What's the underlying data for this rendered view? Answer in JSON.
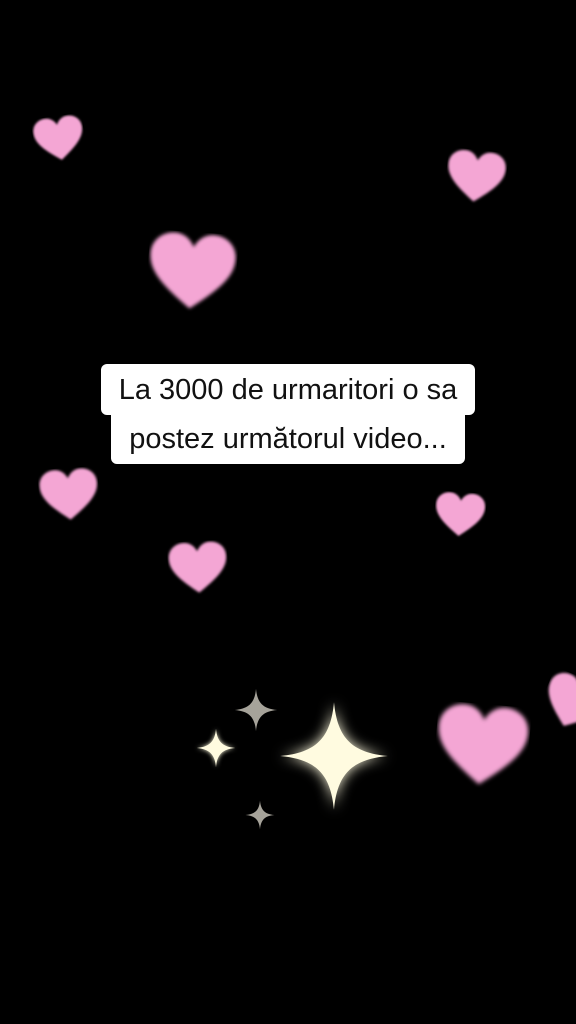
{
  "caption": {
    "line1": "La 3000 de urmaritori o sa",
    "line2": "postez următorul video..."
  },
  "decorations": {
    "heart_color": "#f4a6d4",
    "sparkle_color": "#fffbe0",
    "sparkle_dim_color": "#a6a39a",
    "background_color": "#000000",
    "heart_icon": "heart-icon",
    "sparkle_icon": "sparkle-icon"
  }
}
